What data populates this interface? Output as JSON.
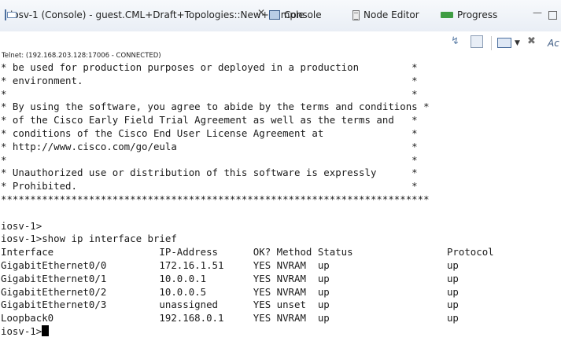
{
  "tabs": {
    "active_title": "iosv-1  (Console) - guest.CML+Draft+Topologies::New+Sample",
    "close_glyph": "✕",
    "console_label": "Console",
    "node_editor_label": "Node Editor",
    "progress_label": "Progress",
    "minimize_glyph": "—"
  },
  "toolbar": {
    "more_label": "Ac",
    "remove_glyph": "✖",
    "dropdown_glyph": "▼",
    "connect_glyph": "↯"
  },
  "connection_status": "Telnet: (192.168.203.128:17006 - CONNECTED)",
  "terminal": {
    "lines": [
      "* be used for production purposes or deployed in a production         *",
      "* environment.                                                        *",
      "*                                                                     *",
      "* By using the software, you agree to abide by the terms and conditions *",
      "* of the Cisco Early Field Trial Agreement as well as the terms and   *",
      "* conditions of the Cisco End User License Agreement at               *",
      "* http://www.cisco.com/go/eula                                        *",
      "*                                                                     *",
      "* Unauthorized use or distribution of this software is expressly      *",
      "* Prohibited.                                                         *",
      "*************************************************************************",
      "",
      "iosv-1>",
      "iosv-1>show ip interface brief",
      "Interface                  IP-Address      OK? Method Status                Protocol",
      "GigabitEthernet0/0         172.16.1.51     YES NVRAM  up                    up",
      "GigabitEthernet0/1         10.0.0.1        YES NVRAM  up                    up",
      "GigabitEthernet0/2         10.0.0.5        YES NVRAM  up                    up",
      "GigabitEthernet0/3         unassigned      YES unset  up                    up",
      "Loopback0                  192.168.0.1     YES NVRAM  up                    up"
    ],
    "prompt": "iosv-1>"
  }
}
